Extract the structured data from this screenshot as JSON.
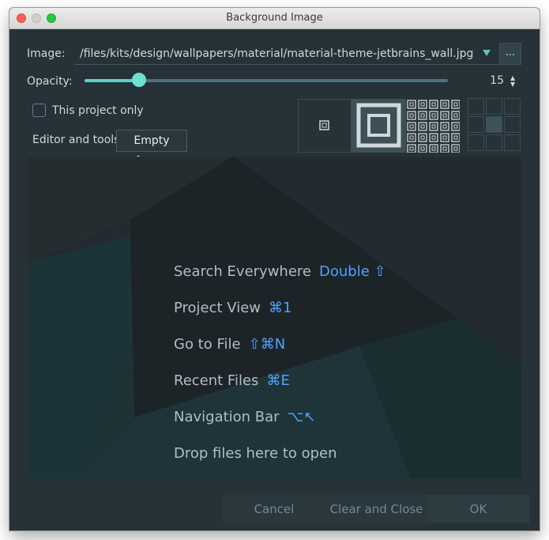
{
  "window": {
    "title": "Background Image"
  },
  "image_field": {
    "label": "Image:",
    "value": "/files/kits/design/wallpapers/material/material-theme-jetbrains_wall.jpg",
    "more_label": "..."
  },
  "opacity": {
    "label": "Opacity:",
    "value": "15",
    "level_percent": 15
  },
  "this_project_only": {
    "label": "This project only",
    "checked": false
  },
  "target": {
    "label": "Editor and tools",
    "value": "Empty frame"
  },
  "fill_options": [
    "center",
    "scale",
    "tile"
  ],
  "anchor": {
    "selected": "center"
  },
  "preview": {
    "shortcuts": [
      {
        "label": "Search Everywhere",
        "shortcut": "Double ⇧"
      },
      {
        "label": "Project View",
        "shortcut": "⌘1"
      },
      {
        "label": "Go to File",
        "shortcut": "⇧⌘N"
      },
      {
        "label": "Recent Files",
        "shortcut": "⌘E"
      },
      {
        "label": "Navigation Bar",
        "shortcut": "⌥↖"
      },
      {
        "label": "Drop files here to open",
        "shortcut": ""
      }
    ]
  },
  "footer": {
    "cancel_label": "Cancel",
    "clear_label": "Clear and Close",
    "ok_label": "OK"
  },
  "colors": {
    "background": "#263238",
    "accent": "#5fd0c4",
    "shortcut": "#4fa3ff",
    "selected_button": "#2c3c40"
  }
}
